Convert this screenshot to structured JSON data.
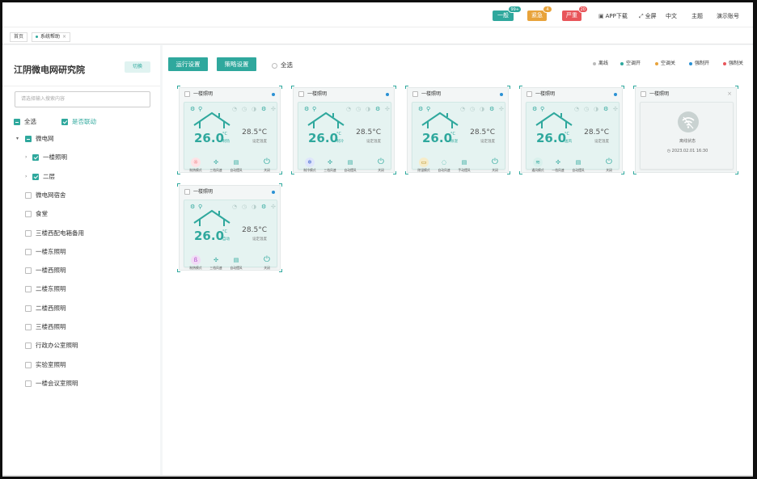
{
  "topbar": {
    "badges": [
      {
        "label": "一般",
        "count": "99+",
        "color": "#2fa89d"
      },
      {
        "label": "紧急",
        "count": "4",
        "color": "#e8a33b"
      },
      {
        "label": "严重",
        "count": "20",
        "color": "#e8555a"
      }
    ],
    "app_download": "APP下载",
    "fullscreen": "全屏",
    "language": "中文",
    "theme": "主题",
    "account": "演示账号"
  },
  "tabs": [
    {
      "label": "首页"
    },
    {
      "label": "系统帮助"
    }
  ],
  "sidebar": {
    "org_name": "江阴微电网研究院",
    "switch_label": "切换",
    "search_placeholder": "请选择输入搜索内容",
    "select_all": "全选",
    "linkage": "是否联动",
    "tree": [
      {
        "label": "微电网",
        "level": 0,
        "state": "half",
        "expander": "▾"
      },
      {
        "label": "一楼照明",
        "level": 1,
        "state": "on",
        "expander": "›"
      },
      {
        "label": "二层",
        "level": 1,
        "state": "on",
        "expander": "›"
      },
      {
        "label": "微电网宿舍",
        "level": 0,
        "state": "off"
      },
      {
        "label": "食堂",
        "level": 0,
        "state": "off"
      },
      {
        "label": "三楼西配电箱备用",
        "level": 0,
        "state": "off"
      },
      {
        "label": "一楼东照明",
        "level": 0,
        "state": "off"
      },
      {
        "label": "一楼西照明",
        "level": 0,
        "state": "off"
      },
      {
        "label": "二楼东照明",
        "level": 0,
        "state": "off"
      },
      {
        "label": "二楼西照明",
        "level": 0,
        "state": "off"
      },
      {
        "label": "三楼西照明",
        "level": 0,
        "state": "off"
      },
      {
        "label": "行政办公室照明",
        "level": 0,
        "state": "off"
      },
      {
        "label": "实验室照明",
        "level": 0,
        "state": "off"
      },
      {
        "label": "一楼会议室照明",
        "level": 0,
        "state": "off"
      }
    ]
  },
  "toolbar": {
    "run_settings": "运行设置",
    "strategy_settings": "策略设置",
    "select_all": "全选"
  },
  "legend": [
    {
      "label": "离线",
      "color": "#bbbbbb"
    },
    {
      "label": "空调开",
      "color": "#2fa89d"
    },
    {
      "label": "空调关",
      "color": "#e8a33b"
    },
    {
      "label": "强制开",
      "color": "#2a91d4"
    },
    {
      "label": "强制关",
      "color": "#e8555a"
    }
  ],
  "cards": [
    {
      "title": "一楼照明",
      "temp": "26.0",
      "unit": "°C",
      "mode_text": "制热",
      "set_temp": "28.5°C",
      "set_label": "设定温度",
      "modes": [
        {
          "icon": "☼",
          "label": "制热模式",
          "bg": "#fde3e6",
          "fg": "#e8555a"
        },
        {
          "icon": "✣",
          "label": "三档风速"
        },
        {
          "icon": "▤",
          "label": "自动摆风"
        },
        {
          "icon": "⏻",
          "label": "关闭",
          "power": true
        }
      ]
    },
    {
      "title": "一楼照明",
      "temp": "26.0",
      "unit": "°C",
      "mode_text": "制冷",
      "set_temp": "28.5°C",
      "set_label": "设定温度",
      "modes": [
        {
          "icon": "❄",
          "label": "制冷模式",
          "bg": "#dfe6fb",
          "fg": "#4a6fd1"
        },
        {
          "icon": "✣",
          "label": "三档风速"
        },
        {
          "icon": "▤",
          "label": "自动摆风"
        },
        {
          "icon": "⏻",
          "label": "关闭",
          "power": true
        }
      ]
    },
    {
      "title": "一楼照明",
      "temp": "26.0",
      "unit": "°C",
      "mode_text": "除湿",
      "set_temp": "28.5°C",
      "set_label": "设定温度",
      "modes": [
        {
          "icon": "▭",
          "label": "除湿模式",
          "bg": "#f6ecc9",
          "fg": "#b38a1d"
        },
        {
          "icon": "◌",
          "label": "自动风速"
        },
        {
          "icon": "▤",
          "label": "手动摆风"
        },
        {
          "icon": "⏻",
          "label": "关闭",
          "power": true
        }
      ]
    },
    {
      "title": "一楼照明",
      "temp": "26.0",
      "unit": "°C",
      "mode_text": "送风",
      "set_temp": "28.5°C",
      "set_label": "设定温度",
      "modes": [
        {
          "icon": "≋",
          "label": "通风模式",
          "bg": "#d9f0ec",
          "fg": "#2fa89d"
        },
        {
          "icon": "✣",
          "label": "一档风速"
        },
        {
          "icon": "▤",
          "label": "自动摆风"
        },
        {
          "icon": "⏻",
          "label": "关闭",
          "power": true
        }
      ]
    },
    {
      "title": "一楼照明",
      "temp": "26.0",
      "unit": "°C",
      "mode_text": "自动",
      "set_temp": "28.5°C",
      "set_label": "设定温度",
      "modes": [
        {
          "icon": "ß",
          "label": "制热模式",
          "bg": "#f1dcf6",
          "fg": "#b04cc9"
        },
        {
          "icon": "✣",
          "label": "三档风速"
        },
        {
          "icon": "▤",
          "label": "自动摆风"
        },
        {
          "icon": "⏻",
          "label": "关闭",
          "power": true
        }
      ]
    }
  ],
  "offline_card": {
    "title": "一楼照明",
    "close": "×",
    "status_text": "离线状态",
    "time": "2023.02.01 16:30"
  }
}
